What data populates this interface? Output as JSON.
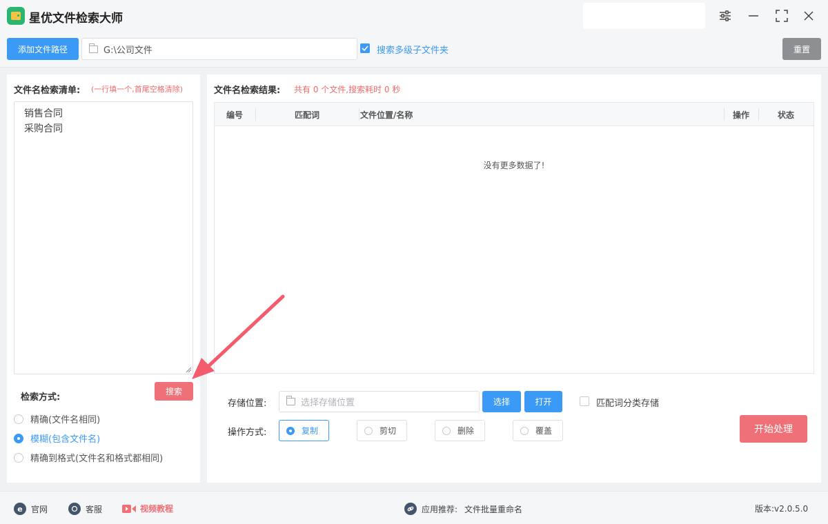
{
  "titlebar": {
    "app_title": "星优文件检索大师",
    "icons": [
      "settings-sliders-icon",
      "minimize-icon",
      "maximize-icon",
      "close-icon"
    ]
  },
  "toolbar": {
    "add_path_label": "添加文件路径",
    "path_value": "G:\\公司文件",
    "include_subfolders_label": "搜索多级子文件夹",
    "include_subfolders_checked": true,
    "reset_label": "重置"
  },
  "keyword_panel": {
    "title": "文件名检索清单:",
    "hint": "(一行填一个,首尾空格清除)",
    "keywords": [
      "销售合同",
      "采购合同"
    ],
    "search_label": "搜索",
    "method_label": "检索方式:",
    "methods": [
      {
        "label": "精确(文件名相同)",
        "selected": false
      },
      {
        "label": "模糊(包含文件名)",
        "selected": true
      },
      {
        "label": "精确到格式(文件名和格式都相同)",
        "selected": false
      }
    ]
  },
  "results": {
    "title": "文件名检索结果:",
    "summary": "共有 0 个文件,搜索耗时 0 秒",
    "columns": [
      "编号",
      "匹配词",
      "文件位置/名称",
      "操作",
      "状态"
    ],
    "rows": [],
    "empty_text": "没有更多数据了!"
  },
  "storage": {
    "label": "存储位置:",
    "placeholder": "选择存储位置",
    "choose_label": "选择",
    "open_label": "打开",
    "classify_label": "匹配词分类存储",
    "classify_checked": false
  },
  "operation": {
    "label": "操作方式:",
    "options": [
      {
        "label": "复制",
        "selected": true
      },
      {
        "label": "剪切",
        "selected": false
      },
      {
        "label": "删除",
        "selected": false
      },
      {
        "label": "覆盖",
        "selected": false
      }
    ],
    "start_label": "开始处理"
  },
  "footer": {
    "website_label": "官网",
    "support_label": "客服",
    "video_label": "视频教程",
    "recommend_label": "应用推荐:",
    "recommend_app": "文件批量重命名",
    "version": "版本:v2.0.5.0"
  },
  "colors": {
    "accent_blue": "#3b9af5",
    "accent_red": "#ef7076",
    "hint_red": "#f06b6b",
    "logo_green": "#2bb573",
    "annotation_arrow": "#f45b6c"
  }
}
